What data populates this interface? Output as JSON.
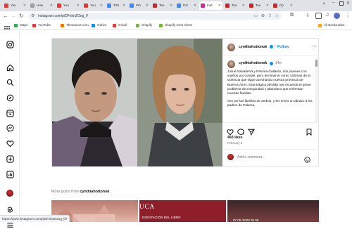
{
  "browser": {
    "tabs": [
      {
        "label": "You",
        "color": "#e53935"
      },
      {
        "label": "How",
        "color": "#9e9e9e"
      },
      {
        "label": "You",
        "color": "#e53935"
      },
      {
        "label": "You",
        "color": "#e53935"
      },
      {
        "label": "TWi",
        "color": "#4285f4"
      },
      {
        "label": "Wh",
        "color": "#4285f4"
      },
      {
        "label": "Tee",
        "color": "#c62828"
      },
      {
        "label": "Pal",
        "color": "#4285f4"
      },
      {
        "label": "Inst",
        "color": "#d6249f"
      },
      {
        "label": "Tee",
        "color": "#c62828"
      },
      {
        "label": "Tee",
        "color": "#c62828"
      },
      {
        "label": "(9)",
        "color": "#c62828"
      }
    ],
    "url": "instagram.com/p/DFxknZGog_f/",
    "bookmarks": [
      {
        "label": "Maps",
        "color": "#34a853"
      },
      {
        "label": "YouTube",
        "color": "#e53935"
      },
      {
        "label": "Thesaurus.com",
        "color": "#f57c00"
      },
      {
        "label": "Gdrive",
        "color": "#1e88e5"
      },
      {
        "label": "Gmail",
        "color": "#e53935"
      },
      {
        "label": "Shopify",
        "color": "#7cb342"
      },
      {
        "label": "Shopify work sheet",
        "color": "#7cb342"
      }
    ],
    "all_bookmarks": "All Bookmarks",
    "status_url": "https://www.instagram.com/p/DFxknZGog_f/#"
  },
  "post": {
    "username": "cynthiahottonok",
    "follow": "Follow",
    "separator": "•",
    "time_ago": "14w",
    "caption_p1": "Josué Salvatierra y Paloma Gallardo, dos jóvenes con sueños por cumplir, pero terminaron como víctimas de la violencia que sigue acechando nuestra provincia de Buenos Aires. Esta trágica pérdida nos recuerda el grave problema de inseguridad y abandono que enfrentan muchas familias.",
    "caption_p2": "Oro por las familias de ambos, y les envío un abrazo a los padres de Paloma,",
    "likes": "493 likes",
    "date": "February 5",
    "comment_placeholder": "Add a comment…"
  },
  "more_posts": {
    "title": "More posts from",
    "username": "cynthiahottonok",
    "thumb2_text": "UCA",
    "thumb2_caption": "ESENTACIÓN DEL LIBRO",
    "thumb3_text": "07 05 /2025 05 09"
  },
  "colors": {
    "accent": "#0095f6",
    "verified": "#0095f6",
    "tab_bar": "#dfe3e8"
  }
}
